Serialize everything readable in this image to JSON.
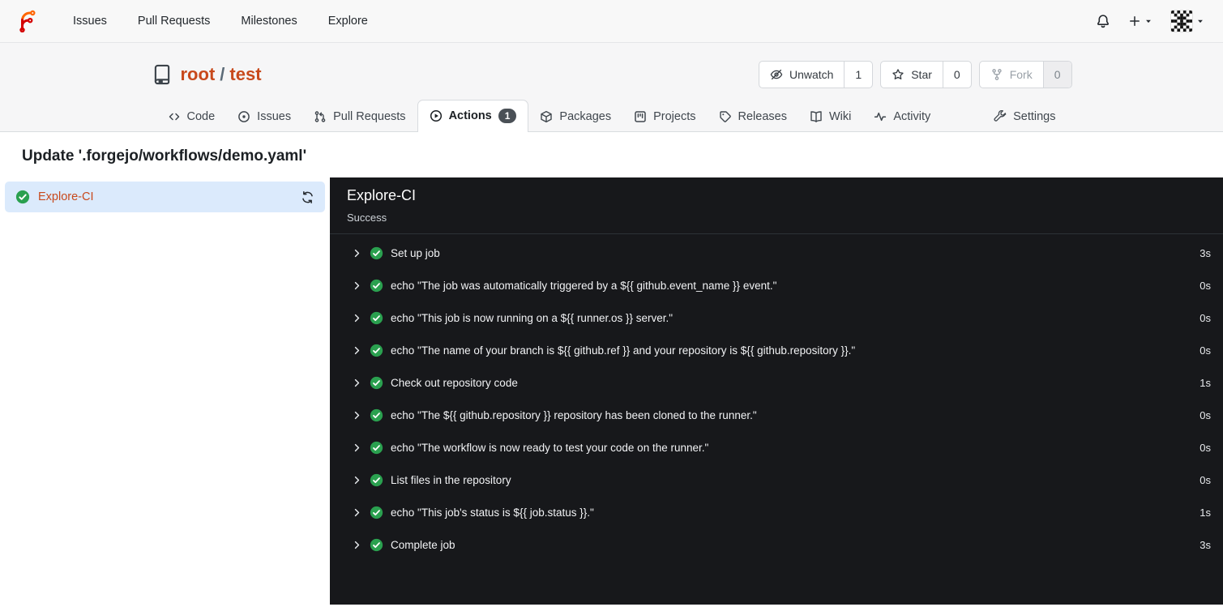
{
  "navbar": {
    "items": [
      {
        "label": "Issues"
      },
      {
        "label": "Pull Requests"
      },
      {
        "label": "Milestones"
      },
      {
        "label": "Explore"
      }
    ]
  },
  "repo": {
    "owner": "root",
    "slash": "/",
    "name": "test",
    "buttons": {
      "unwatch": {
        "label": "Unwatch",
        "count": "1"
      },
      "star": {
        "label": "Star",
        "count": "0"
      },
      "fork": {
        "label": "Fork",
        "count": "0"
      }
    }
  },
  "tabs": [
    {
      "label": "Code"
    },
    {
      "label": "Issues"
    },
    {
      "label": "Pull Requests"
    },
    {
      "label": "Actions",
      "badge": "1"
    },
    {
      "label": "Packages"
    },
    {
      "label": "Projects"
    },
    {
      "label": "Releases"
    },
    {
      "label": "Wiki"
    },
    {
      "label": "Activity"
    },
    {
      "label": "Settings"
    }
  ],
  "run": {
    "title": "Update '.forgejo/workflows/demo.yaml'",
    "jobs": [
      {
        "name": "Explore-CI",
        "status": "success"
      }
    ],
    "panel": {
      "job_name": "Explore-CI",
      "status_text": "Success",
      "steps": [
        {
          "name": "Set up job",
          "duration": "3s"
        },
        {
          "name": "echo \"The job was automatically triggered by a ${{ github.event_name }} event.\"",
          "duration": "0s"
        },
        {
          "name": "echo \"This job is now running on a ${{ runner.os }} server.\"",
          "duration": "0s"
        },
        {
          "name": "echo \"The name of your branch is ${{ github.ref }} and your repository is ${{ github.repository }}.\"",
          "duration": "0s"
        },
        {
          "name": "Check out repository code",
          "duration": "1s"
        },
        {
          "name": "echo \"The ${{ github.repository }} repository has been cloned to the runner.\"",
          "duration": "0s"
        },
        {
          "name": "echo \"The workflow is now ready to test your code on the runner.\"",
          "duration": "0s"
        },
        {
          "name": "List files in the repository",
          "duration": "0s"
        },
        {
          "name": "echo \"This job's status is ${{ job.status }}.\"",
          "duration": "1s"
        },
        {
          "name": "Complete job",
          "duration": "3s"
        }
      ]
    }
  },
  "colors": {
    "accent_orange": "#c8491c",
    "logo_orange": "#ff6600",
    "logo_red": "#d40000",
    "success_green": "#2aa04f",
    "panel_bg": "#17181b",
    "selected_job_bg": "#dbeafc",
    "badge_bg": "#4a5056"
  }
}
